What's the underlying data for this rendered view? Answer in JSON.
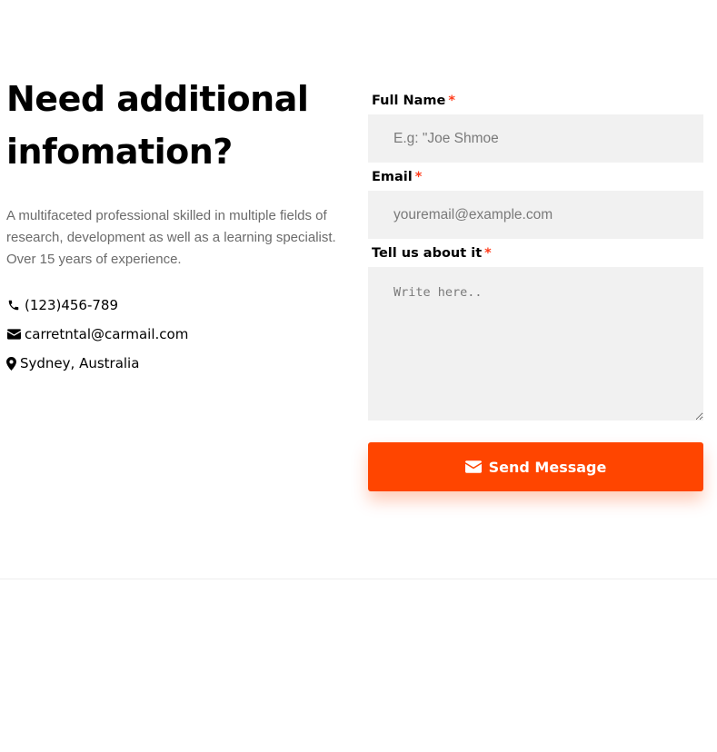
{
  "intro": {
    "heading_line1": "Need additional",
    "heading_line2": "infomation?",
    "description": "A multifaceted professional skilled in multiple fields of research, development as well as a learning specialist. Over 15 years of experience."
  },
  "contact": {
    "phone": "(123)456-789",
    "email": "carretntal@carmail.com",
    "location": "Sydney, Australia",
    "icons": [
      "phone-icon",
      "envelope-icon",
      "map-marker-icon"
    ]
  },
  "form": {
    "required_marker": "*",
    "full_name": {
      "label": "Full Name",
      "placeholder": "E.g: \"Joe Shmoe"
    },
    "email": {
      "label": "Email",
      "placeholder": "youremail@example.com"
    },
    "message": {
      "label": "Tell us about it",
      "placeholder": "Write here.."
    },
    "submit_label": "Send Message",
    "submit_icon": "envelope-icon"
  },
  "colors": {
    "accent": "#ff4500",
    "required": "#ff3b1a",
    "field_bg": "#f1f1f1",
    "muted_text": "#6b6b6b"
  }
}
